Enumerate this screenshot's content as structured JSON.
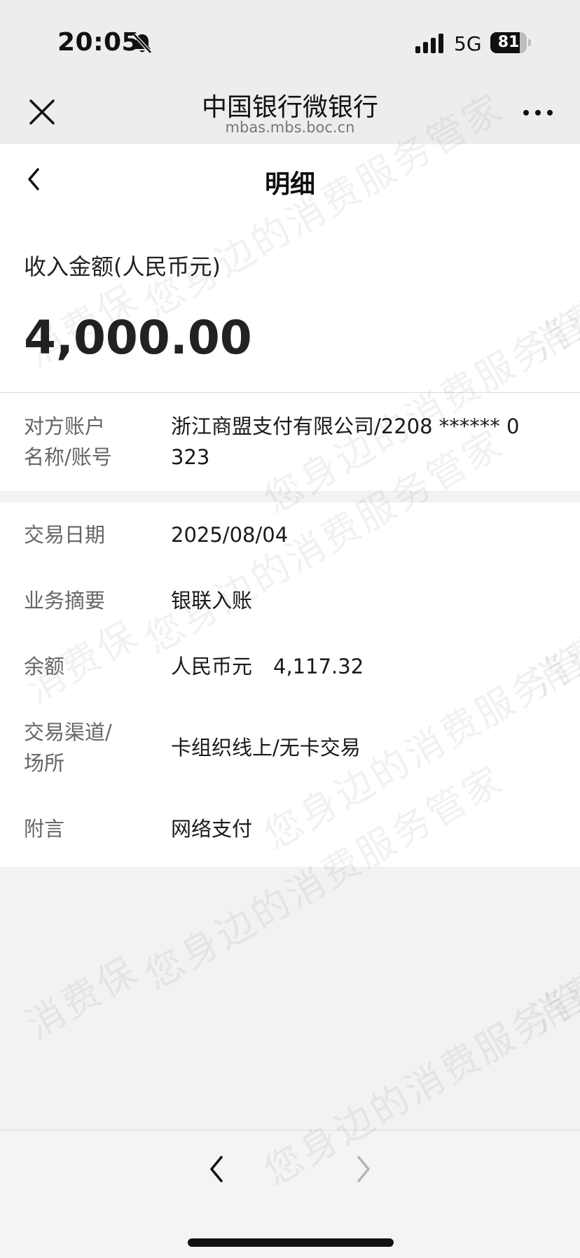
{
  "status_bar": {
    "time": "20:05",
    "network": "5G",
    "battery_level": "81",
    "battery_fraction": 0.81
  },
  "nav": {
    "title": "中国银行微银行",
    "url": "mbas.mbs.boc.cn"
  },
  "page": {
    "title": "明细",
    "amount_label": "收入金额(人民币元)",
    "amount_value": "4,000.00"
  },
  "counterparty": {
    "label_line1": "对方账户",
    "label_line2": "名称/账号",
    "value_line1": "浙江商盟支付有限公司/2208 ****** 0",
    "value_line2": "323"
  },
  "details": {
    "date_label": "交易日期",
    "date_value": "2025/08/04",
    "summary_label": "业务摘要",
    "summary_value": "银联入账",
    "balance_label": "余额",
    "balance_currency": "人民币元",
    "balance_value": "4,117.32",
    "channel_label_line1": "交易渠道/",
    "channel_label_line2": "场所",
    "channel_value": "卡组织线上/无卡交易",
    "remark_label": "附言",
    "remark_value": "网络支付"
  },
  "watermark": {
    "texts": [
      "消费保",
      "您身边的消费服务管家"
    ]
  },
  "icons": {
    "close": "close-icon",
    "more": "more-icon",
    "back": "back-icon",
    "prev": "chevron-left-icon",
    "next": "chevron-right-icon",
    "bell": "bell-slash-icon",
    "signal": "signal-icon",
    "battery": "battery-icon"
  },
  "colors": {
    "nav_background": "#ededed",
    "page_background": "#f2f2f2",
    "card_background": "#ffffff",
    "label_text": "#666666",
    "value_text": "#1a1a1a"
  }
}
